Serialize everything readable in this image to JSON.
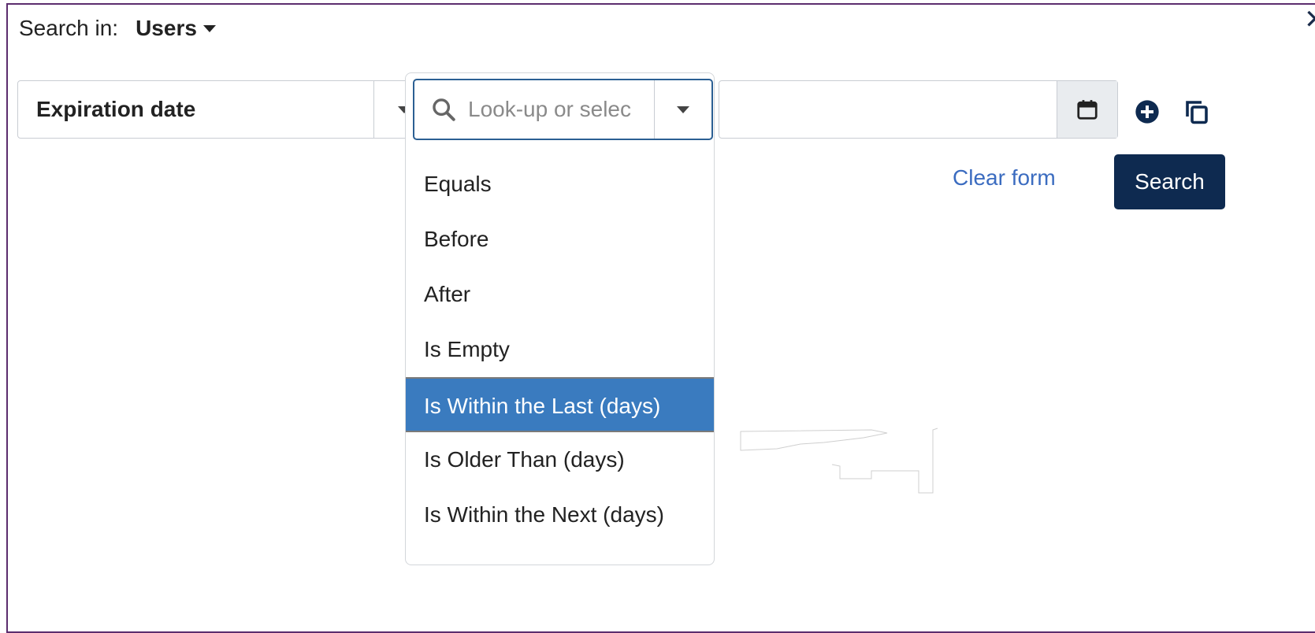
{
  "header": {
    "search_in_label": "Search in:",
    "search_scope": "Users",
    "close_icon": "close-icon"
  },
  "criteria": {
    "field": {
      "value": "Expiration date"
    },
    "operator": {
      "placeholder": "Look-up or selec",
      "value": "",
      "options": [
        "Equals",
        "Before",
        "After",
        "Is Empty",
        "Is Within the Last (days)",
        "Is Older Than (days)",
        "Is Within the Next (days)"
      ],
      "highlighted": "Is Within the Last (days)"
    },
    "date_value": ""
  },
  "actions": {
    "clear_label": "Clear form",
    "search_label": "Search"
  },
  "colors": {
    "accent": "#3a7bbf",
    "primary_button": "#0e2a50",
    "link": "#3b6cc0",
    "panel_border": "#5c2d6e"
  }
}
